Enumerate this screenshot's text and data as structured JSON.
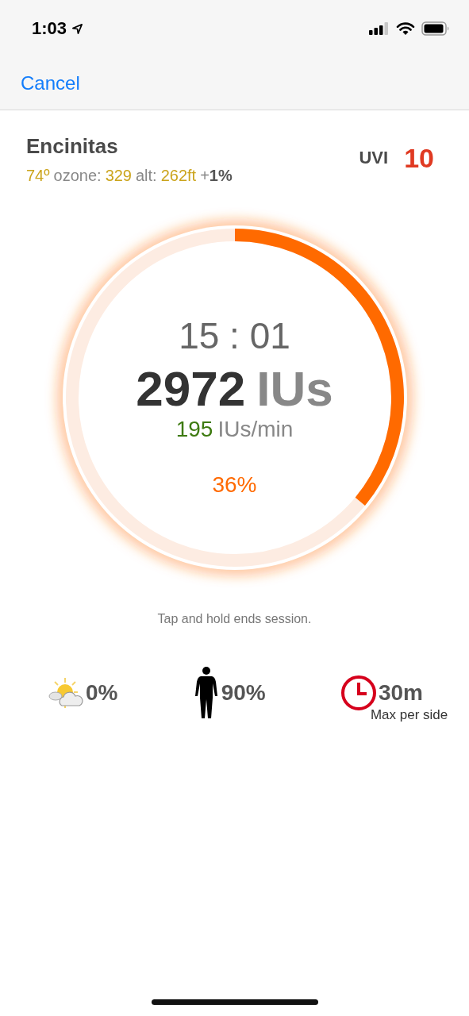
{
  "status_bar": {
    "time": "1:03"
  },
  "nav": {
    "cancel": "Cancel"
  },
  "location": {
    "name": "Encinitas",
    "details": [
      {
        "kind": "value",
        "text": "74º"
      },
      {
        "kind": "label",
        "text": "ozone:"
      },
      {
        "kind": "value",
        "text": "329"
      },
      {
        "kind": "label",
        "text": "alt:"
      },
      {
        "kind": "value",
        "text": "262ft"
      },
      {
        "kind": "delta",
        "text": "+**1%**"
      }
    ]
  },
  "uvi": {
    "label": "UVI",
    "value": "10"
  },
  "session": {
    "timer": "15 : 01",
    "total": "2972",
    "total_unit": "IUs",
    "rate": "195",
    "rate_unit": "IUs/min",
    "percent": "36%",
    "level": 0.36
  },
  "hint": "Tap and hold ends session.",
  "stats": [
    {
      "kind": "cloud",
      "value": "0%"
    },
    {
      "kind": "body",
      "value": "90%"
    },
    {
      "kind": "clock",
      "value": "30m",
      "caption": "Max per side"
    }
  ]
}
